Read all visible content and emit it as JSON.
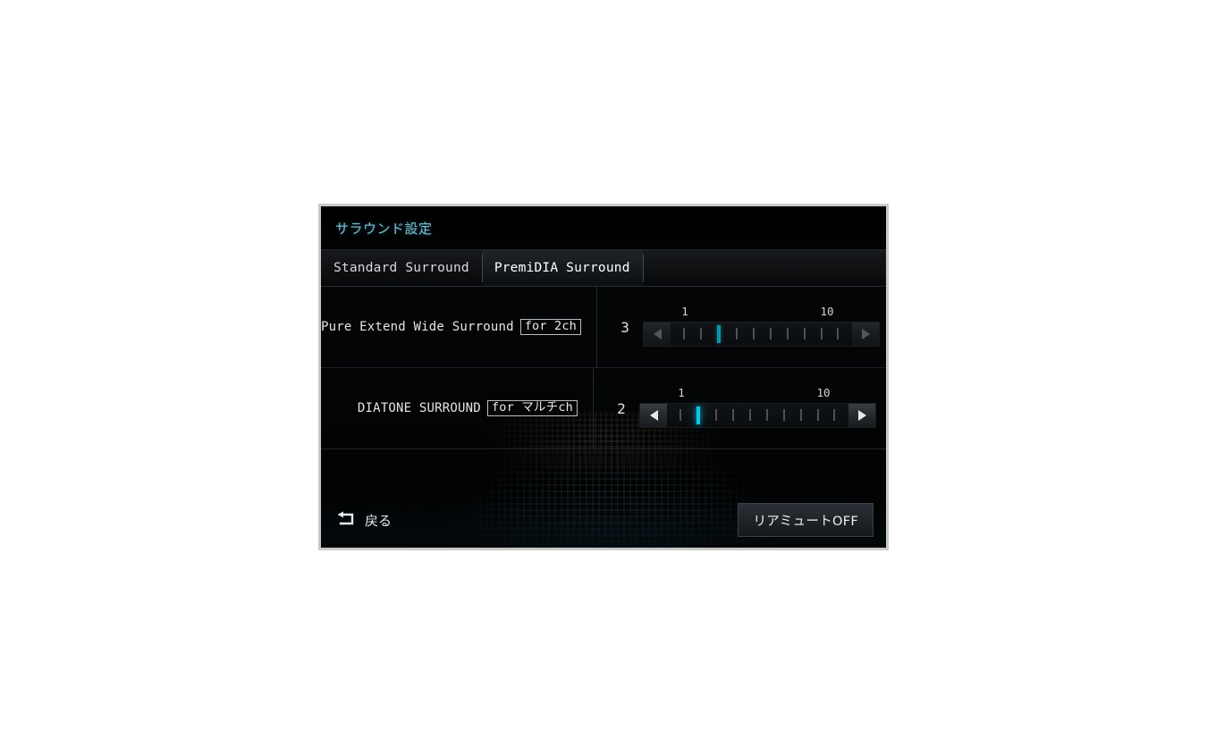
{
  "screen": {
    "title": "サラウンド設定",
    "accent_color": "#79c3d6",
    "slider_active_color": "#0fc4e6"
  },
  "tabs": [
    {
      "label": "Standard Surround",
      "active": false
    },
    {
      "label": "PremiDIA Surround",
      "active": true
    }
  ],
  "settings": [
    {
      "name": "Pure Extend Wide Surround",
      "badge": "for 2ch",
      "value": "3",
      "scale_min": "1",
      "scale_max": "10",
      "ticks": 10,
      "active_tick": 3,
      "arrows_enabled": false
    },
    {
      "name": "DIATONE SURROUND",
      "badge": "for マルチch",
      "value": "2",
      "scale_min": "1",
      "scale_max": "10",
      "ticks": 10,
      "active_tick": 2,
      "arrows_enabled": true
    }
  ],
  "bottom": {
    "back_label": "戻る",
    "back_icon": "return-arrow-icon",
    "rear_mute_label": "リアミュートOFF"
  }
}
